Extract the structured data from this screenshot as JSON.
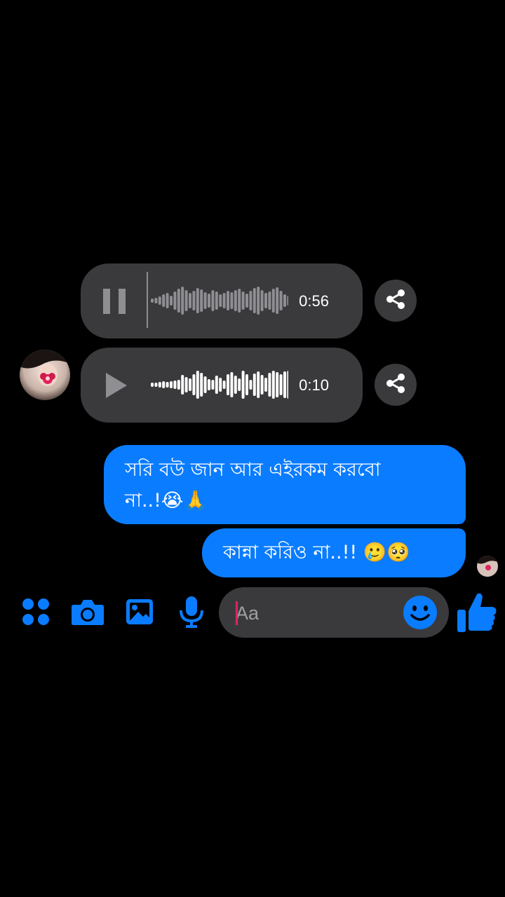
{
  "voice_messages": [
    {
      "state": "playing",
      "control_icon": "pause-icon",
      "duration": "0:56"
    },
    {
      "state": "paused",
      "control_icon": "play-icon",
      "duration": "0:10"
    }
  ],
  "messages": [
    {
      "text_line1": "সরি বউ জান আর এইরকম করবো",
      "text_line2": "না..!😭🙏"
    },
    {
      "text": "কান্না করিও না..!! 🥲🥺"
    }
  ],
  "composer": {
    "placeholder": "Aa"
  },
  "toolbar": {
    "icons": [
      "menu-dots-icon",
      "camera-icon",
      "gallery-icon",
      "microphone-icon",
      "emoji-icon",
      "thumbs-up-icon"
    ]
  },
  "colors": {
    "background": "#000000",
    "accent": "#0a7cff",
    "bubble_gray": "#3a3a3c",
    "caret": "#e0245e"
  }
}
